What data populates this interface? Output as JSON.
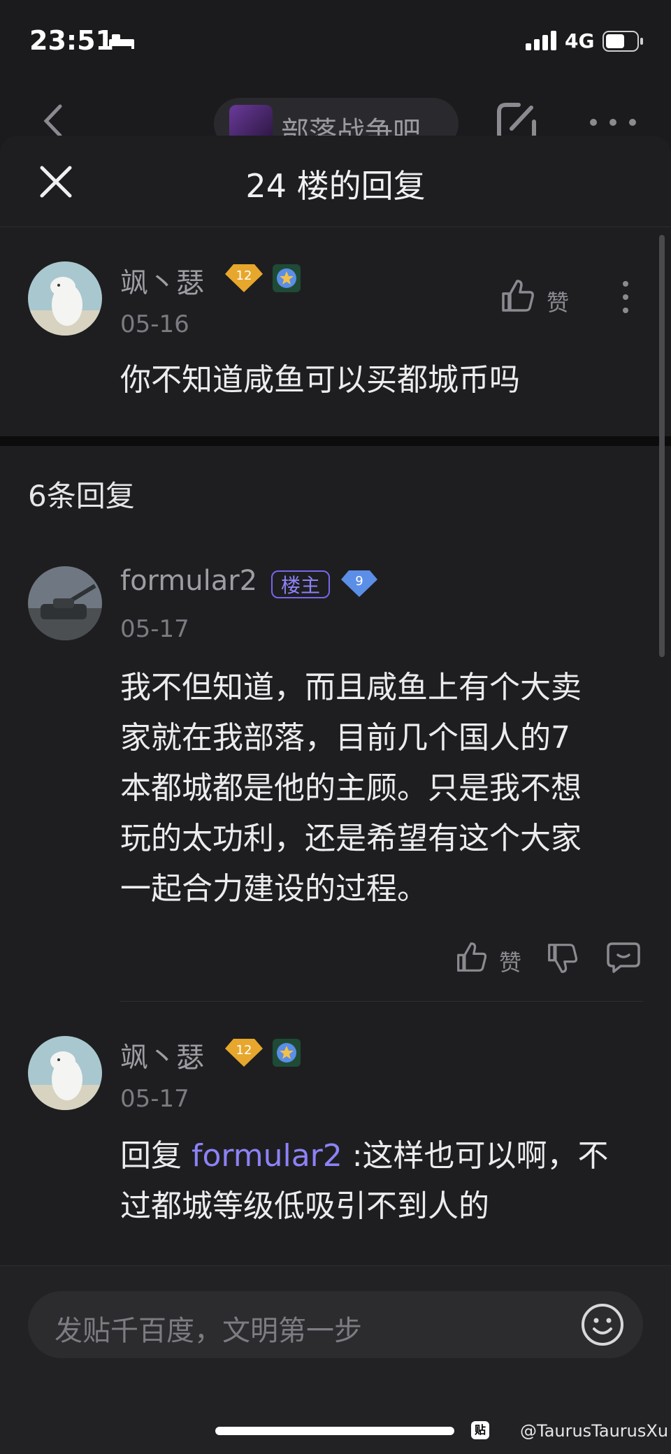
{
  "status": {
    "time": "23:51",
    "network": "4G"
  },
  "background_nav": {
    "forum_name": "部落战争吧"
  },
  "sheet": {
    "title": "24 楼的回复"
  },
  "main_post": {
    "username": "飒丶瑟",
    "level": "12",
    "date": "05-16",
    "like_label": "赞",
    "content": "你不知道咸鱼可以买都城币吗"
  },
  "replies_count": "6条回复",
  "replies": [
    {
      "username": "formular2",
      "badge": "楼主",
      "level": "9",
      "date": "05-17",
      "lines": [
        "我不但知道，而且咸鱼上有个大卖",
        "家就在我部落，目前几个国人的7",
        "本都城都是他的主顾。只是我不想",
        "玩的太功利，还是希望有这个大家",
        "一起合力建设的过程。"
      ],
      "like_label": "赞"
    },
    {
      "username": "飒丶瑟",
      "level": "12",
      "date": "05-17",
      "reply_prefix": "回复",
      "reply_to": "formular2",
      "line1_rest": " :这样也可以啊，不",
      "line2": "过都城等级低吸引不到人的"
    }
  ],
  "composer": {
    "placeholder": "发贴千百度，文明第一步"
  },
  "watermark": {
    "icon": "贴",
    "text": "@TaurusTaurusXu"
  },
  "colors": {
    "accent": "#8d82f7",
    "background": "#1e1e20",
    "gold_badge": "#e7a72c",
    "blue_badge": "#5b8ee6"
  }
}
